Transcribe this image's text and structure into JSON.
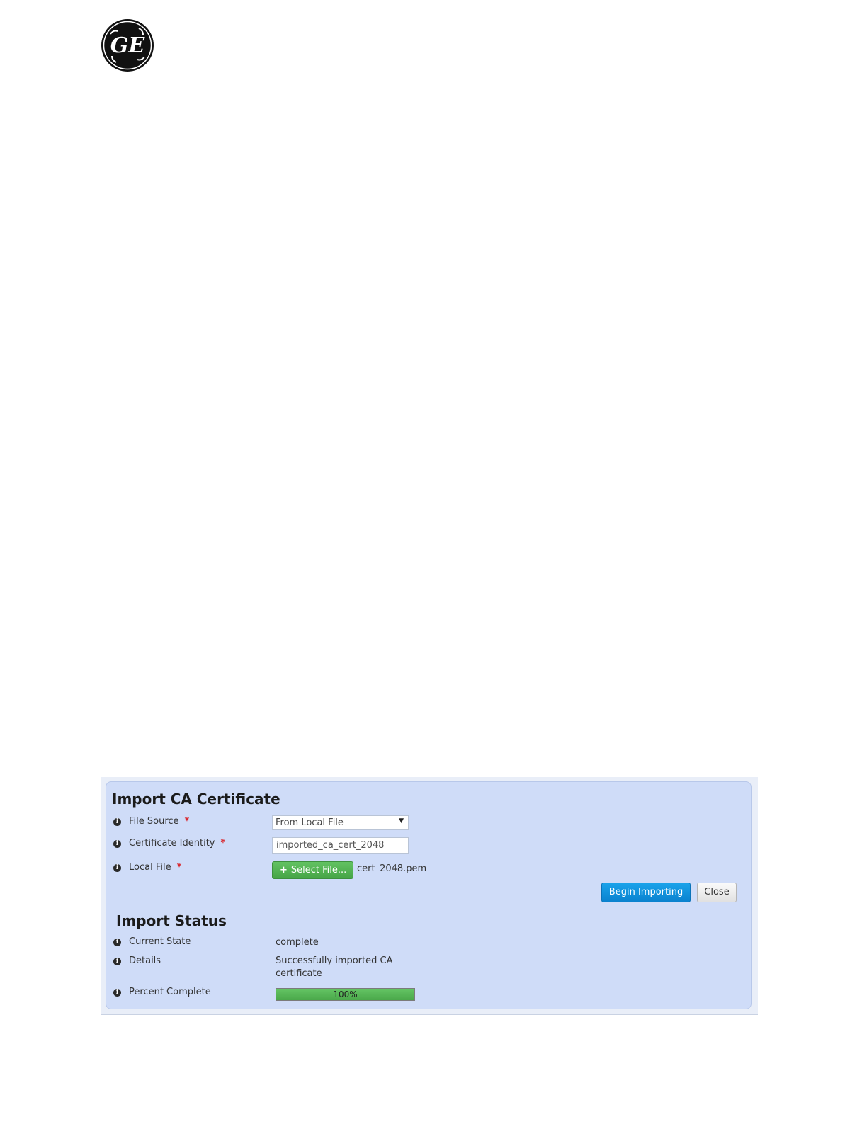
{
  "logo": {
    "text": "GE"
  },
  "import_form": {
    "title": "Import CA Certificate",
    "fields": [
      {
        "label": "File Source",
        "required_mark": "*"
      },
      {
        "label": "Certificate Identity",
        "required_mark": "*"
      },
      {
        "label": "Local File",
        "required_mark": "*"
      }
    ],
    "file_source_value": "From Local File",
    "certificate_identity_value": "imported_ca_cert_2048",
    "select_file_label": "Select File...",
    "selected_file_name": "cert_2048.pem",
    "begin_button_label": "Begin Importing",
    "close_button_label": "Close"
  },
  "import_status": {
    "title": "Import Status",
    "rows": [
      {
        "label": "Current State",
        "value": "complete"
      },
      {
        "label": "Details",
        "value_line1": "Successfully imported CA",
        "value_line2": "certificate"
      },
      {
        "label": "Percent Complete"
      }
    ],
    "progress_fraction": 1.0,
    "progress_text": "100%"
  },
  "colors": {
    "panel_bg": "#cfdcf8",
    "primary_button": "#0a82cf",
    "success_green": "#4aa84a",
    "required_red": "#d9262c"
  }
}
